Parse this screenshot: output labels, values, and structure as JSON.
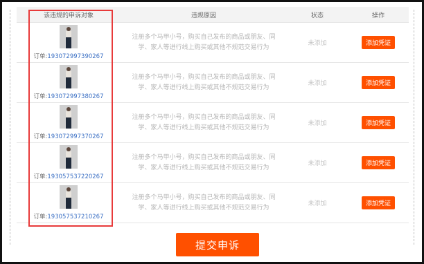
{
  "table": {
    "headers": [
      "该违规的申诉对象",
      "违规原因",
      "状态",
      "操作"
    ],
    "order_prefix": "订单:",
    "rows": [
      {
        "order_number": "193072997390267",
        "reason": "注册多个马甲小号，购买自己发布的商品或朋友、同学、家人等进行线上购买或其他不规范交易行为",
        "status": "未添加",
        "action": "添加凭证",
        "image": "product-thumbnail-jeans"
      },
      {
        "order_number": "193072997380267",
        "reason": "注册多个马甲小号，购买自己发布的商品或朋友、同学、家人等进行线上购买或其他不规范交易行为",
        "status": "未添加",
        "action": "添加凭证",
        "image": "product-thumbnail-jeans"
      },
      {
        "order_number": "193072997370267",
        "reason": "注册多个马甲小号，购买自己发布的商品或朋友、同学、家人等进行线上购买或其他不规范交易行为",
        "status": "未添加",
        "action": "添加凭证",
        "image": "product-thumbnail-jeans"
      },
      {
        "order_number": "193057537220267",
        "reason": "注册多个马甲小号，购买自己发布的商品或朋友、同学、家人等进行线上购买或其他不规范交易行为",
        "status": "未添加",
        "action": "添加凭证",
        "image": "product-thumbnail-jeans"
      },
      {
        "order_number": "193057537210267",
        "reason": "注册多个马甲小号，购买自己发布的商品或朋友、同学、家人等进行线上购买或其他不规范交易行为",
        "status": "未添加",
        "action": "添加凭证",
        "image": "product-thumbnail-jeans"
      }
    ]
  },
  "submit_label": "提交申诉",
  "colors": {
    "accent": "#ff5000",
    "highlight": "#e83a3a",
    "order_link": "#3a6fc4",
    "muted_text": "#b5b5b5"
  }
}
